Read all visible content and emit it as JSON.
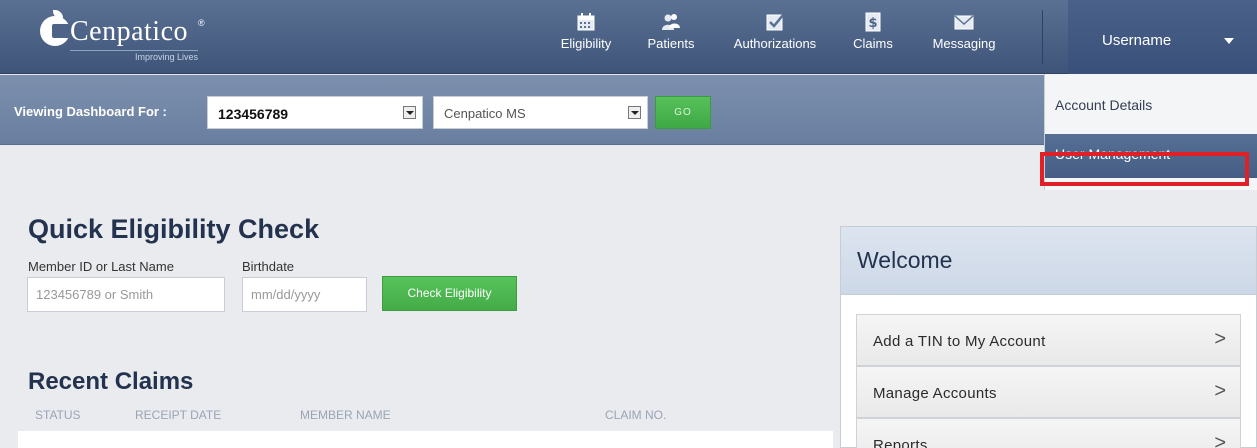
{
  "brand": {
    "name": "Cenpatico",
    "tagline": "Improving Lives",
    "registered_mark": "®"
  },
  "nav": {
    "items": [
      {
        "label": "Eligibility",
        "icon": "calendar-icon"
      },
      {
        "label": "Patients",
        "icon": "people-icon"
      },
      {
        "label": "Authorizations",
        "icon": "checkbox-icon"
      },
      {
        "label": "Claims",
        "icon": "dollar-document-icon"
      },
      {
        "label": "Messaging",
        "icon": "envelope-icon"
      }
    ],
    "username": "Username"
  },
  "user_menu": {
    "items": [
      "Account Details",
      "User Management"
    ],
    "highlighted": "User Management"
  },
  "dashboard_bar": {
    "label": "Viewing Dashboard For :",
    "account_value": "123456789",
    "plan_value": "Cenpatico MS",
    "go_label": "GO"
  },
  "eligibility": {
    "title": "Quick Eligibility Check",
    "member_label": "Member ID or Last Name",
    "member_placeholder": "123456789 or Smith",
    "birthdate_label": "Birthdate",
    "birthdate_placeholder": "mm/dd/yyyy",
    "button_label": "Check Eligibility"
  },
  "recent_claims": {
    "title": "Recent Claims",
    "columns": [
      "STATUS",
      "RECEIPT DATE",
      "MEMBER NAME",
      "CLAIM NO."
    ]
  },
  "welcome": {
    "title": "Welcome",
    "links": [
      {
        "label": "Add a TIN to My Account",
        "arrow": ">"
      },
      {
        "label": "Manage Accounts",
        "arrow": ">"
      },
      {
        "label": "Reports",
        "arrow": ">"
      }
    ]
  },
  "colors": {
    "nav_bg": "#4d6488",
    "accent_green": "#4cb450",
    "highlight_red": "#e02027",
    "heading_navy": "#23324f"
  }
}
